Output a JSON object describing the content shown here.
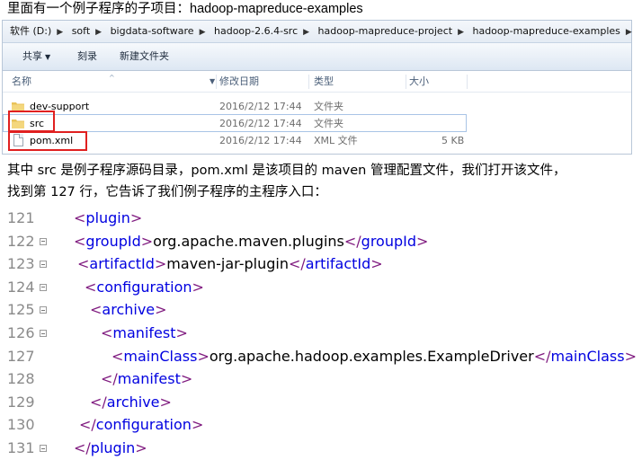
{
  "heading": {
    "prefix": "里面有一个例子程序的子项目：",
    "project": "hadoop-mapreduce-examples"
  },
  "explorer": {
    "breadcrumb": [
      "软件 (D:)",
      "soft",
      "bigdata-software",
      "hadoop-2.6.4-src",
      "hadoop-mapreduce-project",
      "hadoop-mapreduce-examples"
    ],
    "toolbar": {
      "share": "共享",
      "burn": "刻录",
      "new_folder": "新建文件夹"
    },
    "columns": {
      "name": "名称",
      "modified": "修改日期",
      "type": "类型",
      "size": "大小"
    },
    "rows": [
      {
        "name": "dev-support",
        "modified": "2016/2/12 17:44",
        "type": "文件夹",
        "size": "",
        "icon": "folder-icon"
      },
      {
        "name": "src",
        "modified": "2016/2/12 17:44",
        "type": "文件夹",
        "size": "",
        "icon": "folder-icon"
      },
      {
        "name": "pom.xml",
        "modified": "2016/2/12 17:44",
        "type": "XML 文件",
        "size": "5 KB",
        "icon": "xml-file-icon"
      }
    ]
  },
  "paragraph": {
    "line1": "其中 src 是例子程序源码目录，pom.xml 是该项目的 maven 管理配置文件，我们打开该文件，",
    "line2": "找到第 127 行，它告诉了我们例子程序的主程序入口："
  },
  "code": [
    {
      "num": "121",
      "open": "plugin",
      "text": "",
      "close": ""
    },
    {
      "num": "122",
      "open": "groupId",
      "text": "org.apache.maven.plugins",
      "close": "groupId"
    },
    {
      "num": "123",
      "open": "artifactId",
      "text": "maven-jar-plugin",
      "close": "artifactId"
    },
    {
      "num": "124",
      "open": "configuration",
      "text": "",
      "close": ""
    },
    {
      "num": "125",
      "open": "archive",
      "text": "",
      "close": ""
    },
    {
      "num": "126",
      "open": "manifest",
      "text": "",
      "close": ""
    },
    {
      "num": "127",
      "open": "mainClass",
      "text": "org.apache.hadoop.examples.ExampleDriver",
      "close": "mainClass"
    },
    {
      "num": "128",
      "open": "/manifest",
      "text": "",
      "close": ""
    },
    {
      "num": "129",
      "open": "/archive",
      "text": "",
      "close": ""
    },
    {
      "num": "130",
      "open": "/configuration",
      "text": "",
      "close": ""
    },
    {
      "num": "131",
      "open": "/plugin",
      "text": "",
      "close": ""
    }
  ],
  "colors": {
    "bracket": "#7f1a7f",
    "tag": "#0000e0",
    "highlight_box": "#e02020"
  }
}
